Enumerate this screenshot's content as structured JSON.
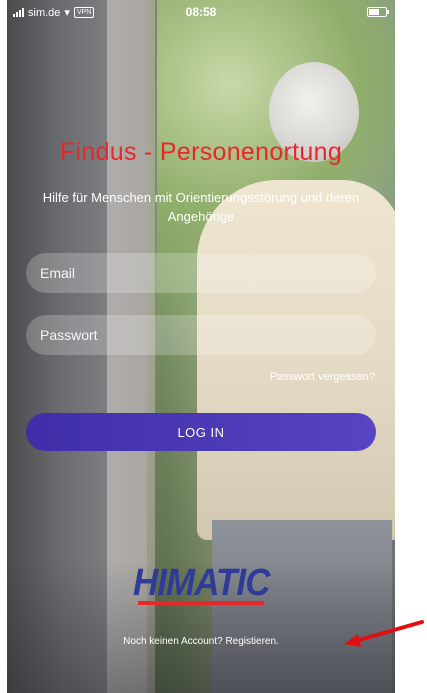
{
  "status_bar": {
    "carrier": "sim.de",
    "vpn": "VPN",
    "time": "08:58"
  },
  "app": {
    "title": "Findus - Personenortung",
    "subtitle": "Hilfe für Menschen mit Orientierungsstörung und deren Angehörige"
  },
  "login_form": {
    "email_placeholder": "Email",
    "email_value": "",
    "password_placeholder": "Passwort",
    "password_value": "",
    "forgot_password": "Passwort vergessen?",
    "login_button": "LOG IN"
  },
  "logo": {
    "text": "HIMATIC"
  },
  "footer": {
    "register": "Noch keinen Account? Registieren."
  },
  "colors": {
    "title_red": "#e8272b",
    "button_purple": "#4a39b8",
    "logo_blue": "#2e3b98",
    "annotation_arrow": "#e10f0f"
  },
  "icons": [
    "signal-icon",
    "wifi-icon",
    "vpn-badge",
    "battery-icon",
    "annotation-arrow-icon"
  ]
}
